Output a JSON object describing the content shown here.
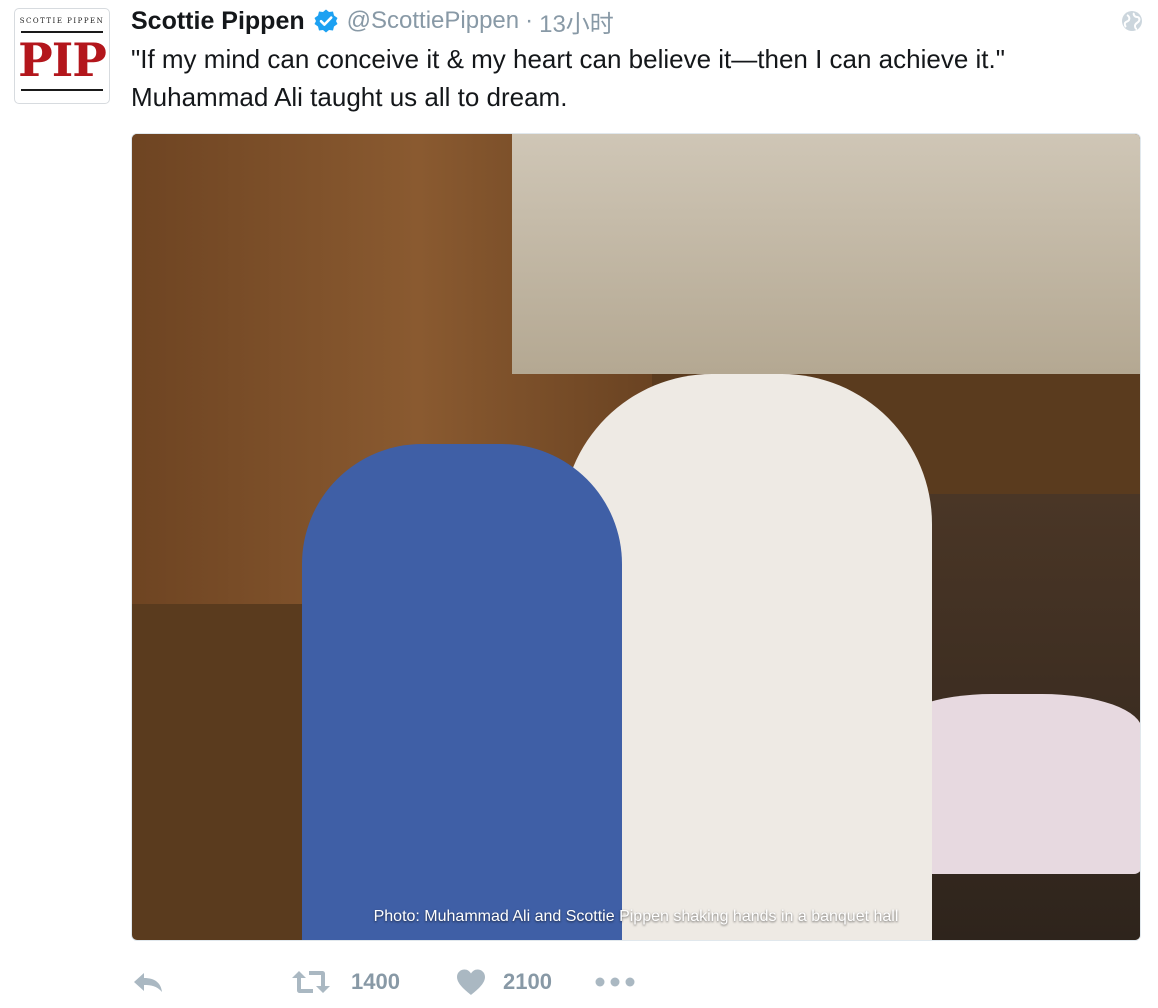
{
  "tweet": {
    "author": {
      "display_name": "Scottie Pippen",
      "handle": "@ScottiePippen",
      "verified": true,
      "avatar": {
        "label": "PIP",
        "small_text": "SCOTTIE PIPPEN",
        "brand_color": "#b3161c"
      }
    },
    "timestamp": "13小时",
    "separator": "·",
    "text_lines": [
      "\"If my mind can conceive it & my heart can believe it—then I can achieve it.\"",
      "Muhammad Ali taught us all to dream."
    ],
    "media": {
      "type": "photo",
      "caption": "Photo: Muhammad Ali and Scottie Pippen shaking hands in a banquet hall"
    },
    "visibility_icon": "globe-icon",
    "actions": {
      "reply": {
        "icon": "reply-icon"
      },
      "retweet": {
        "icon": "retweet-icon",
        "count": "1400"
      },
      "like": {
        "icon": "heart-icon",
        "count": "2100"
      },
      "more": {
        "icon": "more-dots-icon"
      }
    }
  },
  "colors": {
    "text_primary": "#14171a",
    "text_secondary": "#8899a6",
    "verified_blue": "#1da1f2",
    "icon_gray": "#aab8c2"
  }
}
